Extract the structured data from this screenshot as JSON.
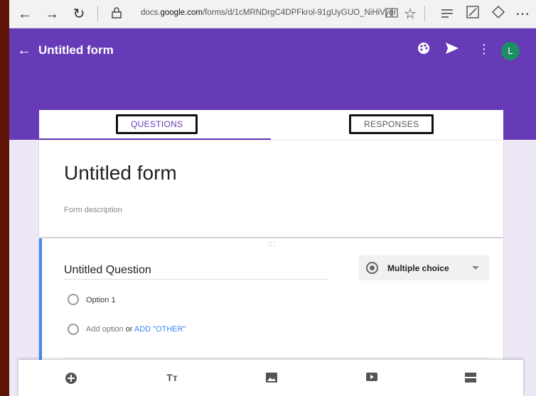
{
  "browser": {
    "back_icon": "back-arrow-icon",
    "forward_icon": "forward-arrow-icon",
    "refresh_icon": "refresh-icon",
    "url_prefix": "docs.",
    "url_domain": "google.com",
    "url_rest": "/forms/d/1cMRNDrgC4DPFkrol-91gUyGUO_NiHiVyor"
  },
  "header": {
    "title": "Untitled form",
    "avatar_letter": "L"
  },
  "tabs": {
    "questions": "QUESTIONS",
    "responses": "RESPONSES"
  },
  "form": {
    "title": "Untitled form",
    "description_placeholder": "Form description"
  },
  "question": {
    "drag_handle": ":::",
    "title": "Untitled Question",
    "type": "Multiple choice",
    "option1": "Option 1",
    "add_option": "Add option",
    "or_text": "or",
    "add_other": "ADD \"OTHER\""
  },
  "toolbar": {
    "add_question_icon": "add-circle-icon",
    "title_text_icon": "text-title-icon",
    "image_icon": "image-icon",
    "video_icon": "video-icon",
    "section_icon": "section-icon"
  },
  "colors": {
    "brand": "#673ab7",
    "accent_blue": "#4285f4",
    "avatar": "#1e8e64"
  }
}
